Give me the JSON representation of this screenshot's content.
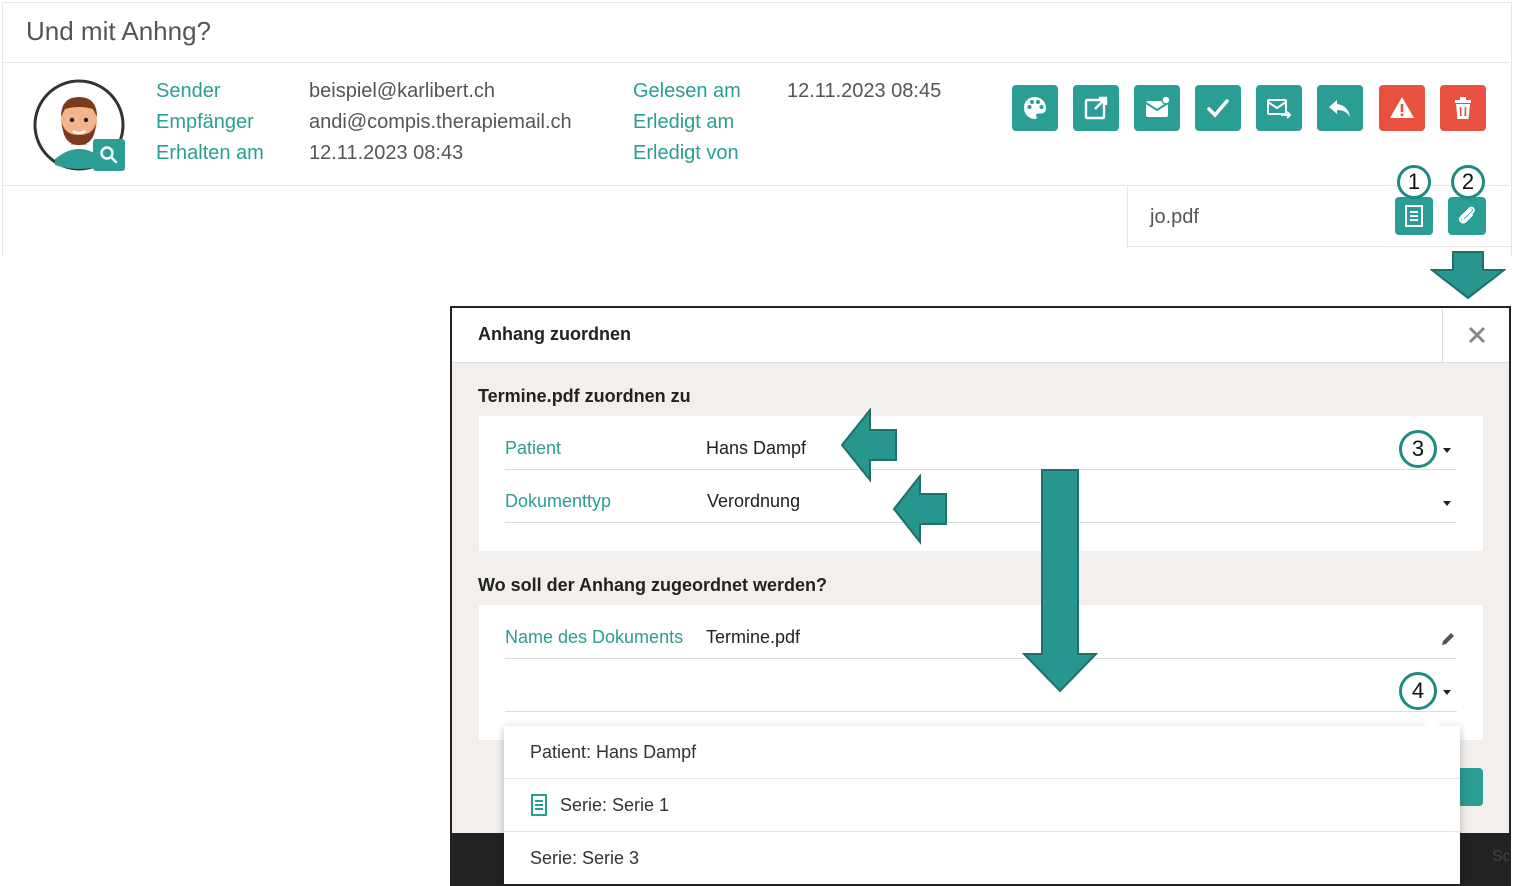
{
  "page": {
    "title": "Und mit Anhng?"
  },
  "meta": {
    "sender_label": "Sender",
    "recipient_label": "Empfänger",
    "received_label": "Erhalten am",
    "sender_value": "beispiel@karlibert.ch",
    "recipient_value": "andi@compis.therapiemail.ch",
    "received_value": "12.11.2023 08:43",
    "read_label": "Gelesen am",
    "done_label": "Erledigt am",
    "done_by_label": "Erledigt von",
    "read_value": "12.11.2023 08:45"
  },
  "toolbar": {
    "icons": [
      "palette-icon",
      "open-external-icon",
      "mark-unread-icon",
      "check-icon",
      "forward-mail-icon",
      "reply-icon",
      "warning-icon",
      "trash-icon"
    ],
    "accent": "#2a9d94",
    "danger": "#e8503f"
  },
  "attachment": {
    "filename": "jo.pdf",
    "callout_1": "1",
    "callout_2": "2"
  },
  "dialog": {
    "title": "Anhang zuordnen",
    "section1_title": "Termine.pdf zuordnen zu",
    "patient_label": "Patient",
    "patient_value": "Hans Dampf",
    "doctype_label": "Dokumenttyp",
    "doctype_value": "Verordnung",
    "section2_title": "Wo soll der Anhang zugeordnet werden?",
    "docname_label": "Name des Dokuments",
    "docname_value": "Termine.pdf",
    "callout_3": "3",
    "callout_4": "4",
    "dropdown_items": [
      "Patient: Hans Dampf",
      "Serie: Serie 1",
      "Serie: Serie 3"
    ],
    "footer_fragment": "Sc"
  }
}
